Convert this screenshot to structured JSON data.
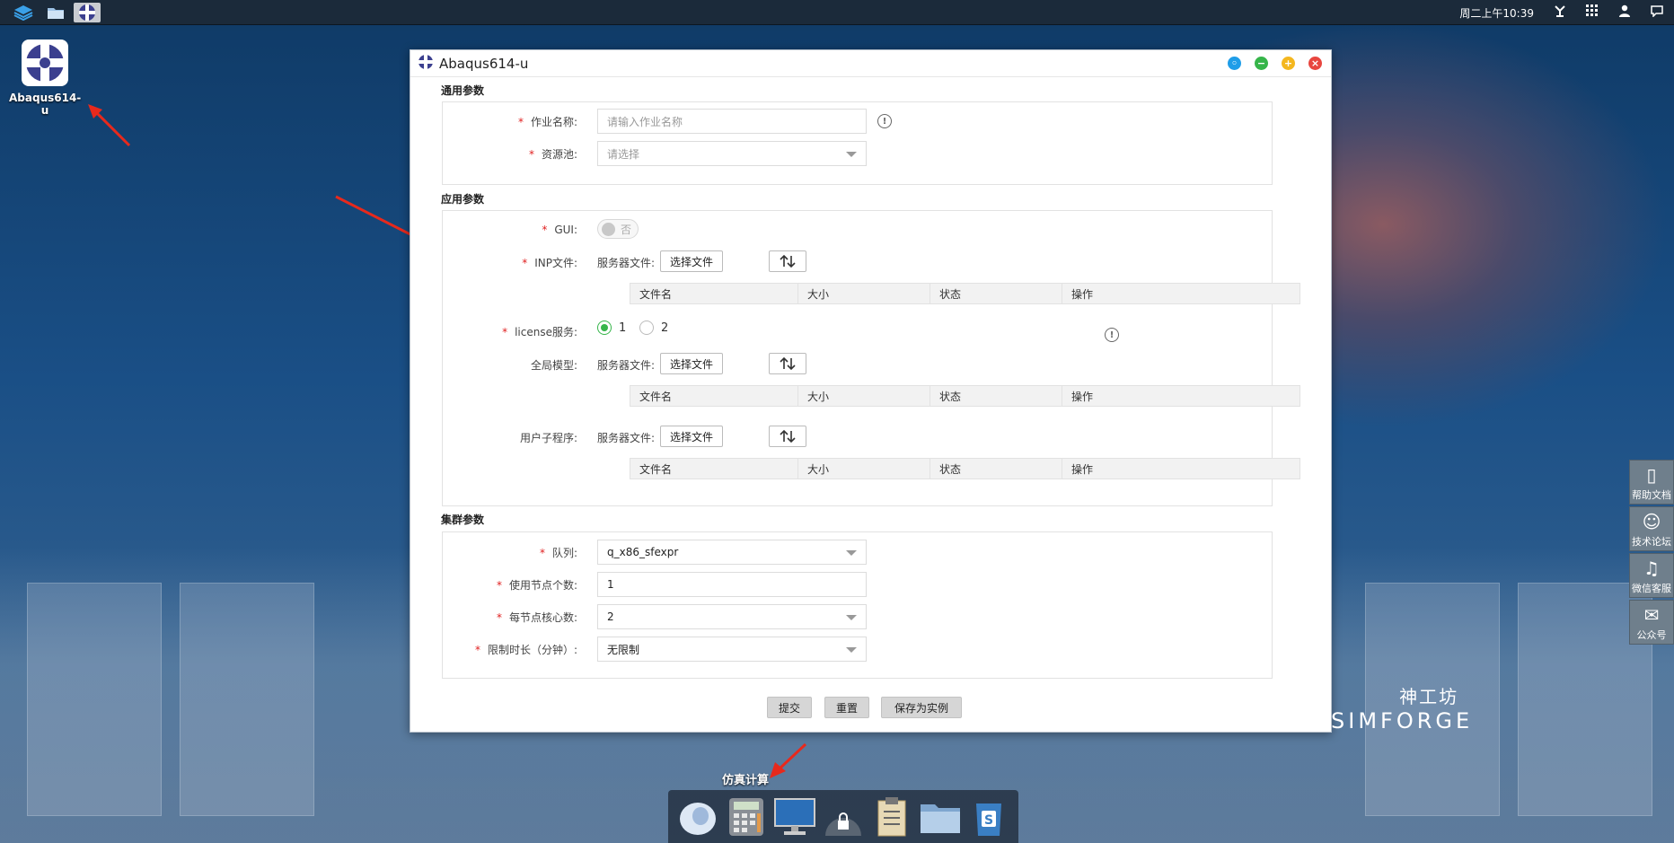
{
  "topbar": {
    "clock": "周二上午10:39",
    "left_icons": [
      "layers-icon",
      "folder-icon",
      "abaqus-icon"
    ],
    "right_icons": [
      "network-icon",
      "apps-grid-icon",
      "user-icon",
      "chat-icon"
    ]
  },
  "desktop": {
    "icon_label": "Abaqus614-u"
  },
  "window": {
    "title": "Abaqus614-u",
    "controls": [
      "settings",
      "minimize",
      "maximize",
      "close"
    ]
  },
  "general": {
    "section_title": "通用参数",
    "job_name_label": "作业名称:",
    "job_name_placeholder": "请输入作业名称",
    "pool_label": "资源池:",
    "pool_placeholder": "请选择"
  },
  "app": {
    "section_title": "应用参数",
    "gui_label": "GUI:",
    "gui_toggle_text": "否",
    "inp_label": "INP文件:",
    "server_file_label": "服务器文件:",
    "choose_file": "选择文件",
    "license_label": "license服务:",
    "license_options": [
      "1",
      "2"
    ],
    "license_selected": "1",
    "global_model_label": "全局模型:",
    "subroutine_label": "用户子程序:",
    "table_headers": [
      "文件名",
      "大小",
      "状态",
      "操作"
    ]
  },
  "cluster": {
    "section_title": "集群参数",
    "queue_label": "队列:",
    "queue_value": "q_x86_sfexpr",
    "nodes_label": "使用节点个数:",
    "nodes_value": "1",
    "cores_label": "每节点核心数:",
    "cores_value": "2",
    "time_label": "限制时长（分钟）:",
    "time_value": "无限制"
  },
  "footer": {
    "submit": "提交",
    "reset": "重置",
    "save_as_instance": "保存为实例"
  },
  "side_tools": [
    "帮助文档",
    "技术论坛",
    "微信客服",
    "公众号"
  ],
  "brand": {
    "cn": "神工坊",
    "en": "SIMFORGE"
  },
  "dock": {
    "label": "仿真计算",
    "items": [
      "shell-app-icon",
      "calculator-icon",
      "monitor-icon",
      "lock-icon",
      "clipboard-icon",
      "folder-icon",
      "s-app-icon"
    ]
  }
}
